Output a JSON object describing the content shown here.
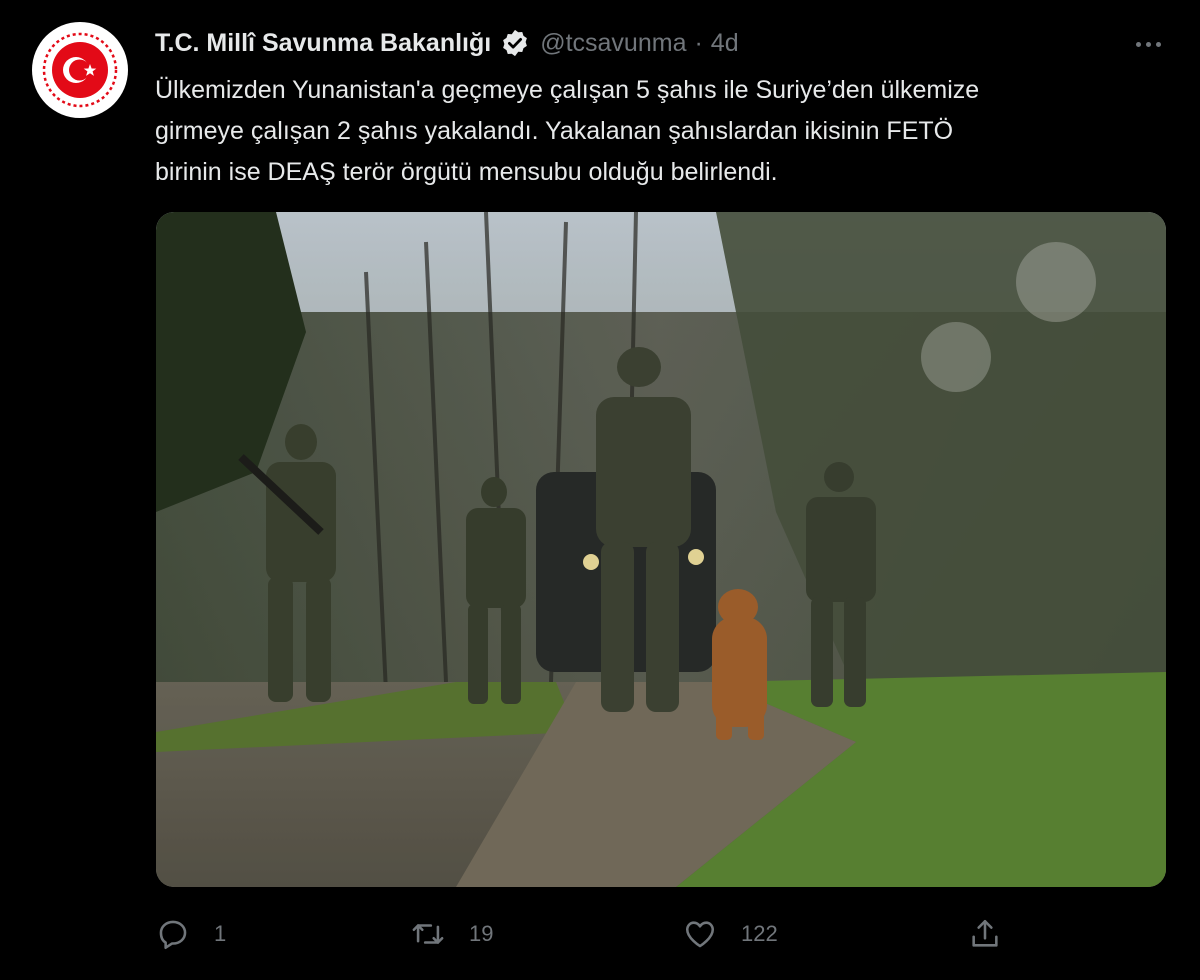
{
  "tweet": {
    "author_name": "T.C. Millî Savunma Bakanlığı",
    "handle": "@tcsavunma",
    "separator": "·",
    "time": "4d",
    "text_lines": [
      "Ülkemizden Yunanistan'a geçmeye çalışan 5 şahıs ile Suriye’den ülkemize",
      "girmeye çalışan 2 şahıs yakalandı. Yakalanan şahıslardan ikisinin FETÖ",
      "birinin ise DEAŞ terör örgütü mensubu olduğu belirlendi."
    ],
    "verified_color": "#e7e9ea",
    "accent_color": "#e30a17"
  },
  "actions": {
    "reply": {
      "icon": "reply-icon",
      "count": "1"
    },
    "retweet": {
      "icon": "retweet-icon",
      "count": "19"
    },
    "like": {
      "icon": "heart-icon",
      "count": "122"
    },
    "share": {
      "icon": "share-icon"
    }
  }
}
